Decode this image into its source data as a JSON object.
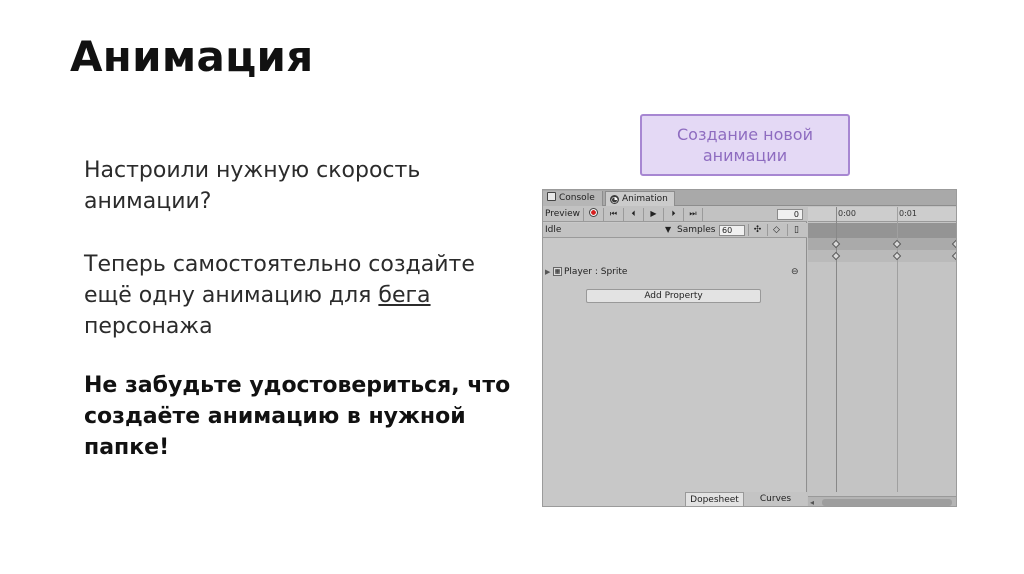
{
  "slide": {
    "title": "Анимация",
    "paragraph1": "Настроили нужную скорость анимации?",
    "paragraph2": {
      "before": "Теперь самостоятельно создайте ещё одну анимацию для ",
      "underlined": "бега",
      "after": " персонажа"
    },
    "paragraph3": "Не забудьте удостовериться, что создаёте анимацию в нужной папке!",
    "callout": "Создание новой анимации"
  },
  "unity_window": {
    "tabs": [
      "Console",
      "Animation"
    ],
    "toolbar": {
      "preview_label": "Preview",
      "buttons": [
        {
          "name": "record-button",
          "icon": "record-icon"
        },
        {
          "name": "first-key-button",
          "icon": "first-key-icon",
          "glyph": "⏮"
        },
        {
          "name": "prev-key-button",
          "icon": "prev-key-icon",
          "glyph": "⏴"
        },
        {
          "name": "play-button",
          "icon": "play-icon",
          "glyph": "▶"
        },
        {
          "name": "next-key-button",
          "icon": "next-key-icon",
          "glyph": "⏵"
        },
        {
          "name": "last-key-button",
          "icon": "last-key-icon",
          "glyph": "⏭"
        }
      ],
      "frame_value": "0"
    },
    "clip_row": {
      "clip_name": "Idle",
      "samples_label": "Samples",
      "samples_value": "60",
      "icons": [
        "add-keyframe-icon",
        "add-event-icon",
        "event-marker-icon"
      ]
    },
    "property": {
      "label": "Player : Sprite",
      "remove_icon": "minus-icon"
    },
    "add_property_label": "Add Property",
    "bottom_tabs": [
      "Dopesheet",
      "Curves"
    ],
    "timeline": {
      "ticks": [
        "0:00",
        "0:01"
      ]
    }
  },
  "colors": {
    "callout_bg": "#e4d9f5",
    "callout_border": "#a787d2",
    "callout_text": "#8e6cc0",
    "record_red": "#d62020"
  }
}
